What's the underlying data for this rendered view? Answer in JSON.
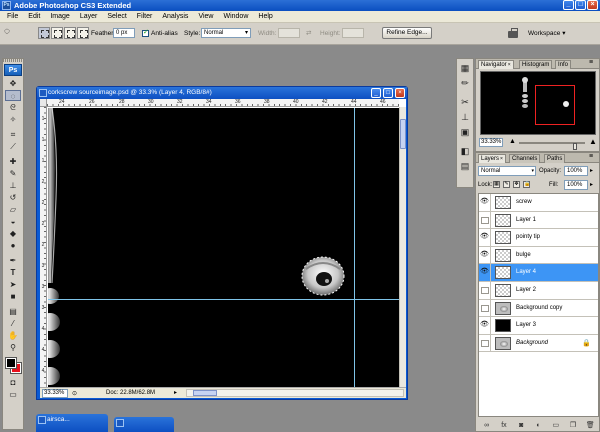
{
  "app": {
    "title": "Adobe Photoshop CS3 Extended",
    "icon": "photoshop-icon",
    "logo": "Ps"
  },
  "window_controls": [
    "minimize",
    "maximize",
    "close"
  ],
  "menu": [
    "File",
    "Edit",
    "Image",
    "Layer",
    "Select",
    "Filter",
    "Analysis",
    "View",
    "Window",
    "Help"
  ],
  "options_bar": {
    "feather_label": "Feather:",
    "feather_value": "0 px",
    "antialias_label": "Anti-alias",
    "antialias_checked": true,
    "style_label": "Style:",
    "style_value": "Normal",
    "width_label": "Width:",
    "height_label": "Height:",
    "refine_edge": "Refine Edge...",
    "workspace": "Workspace"
  },
  "toolbox": {
    "tools": [
      "move-tool-icon",
      "marquee-tool-icon",
      "lasso-tool-icon",
      "magic-wand-icon",
      "crop-tool-icon",
      "slice-tool-icon",
      "healing-brush-icon",
      "brush-tool-icon",
      "clone-stamp-icon",
      "history-brush-icon",
      "eraser-tool-icon",
      "paint-bucket-icon",
      "blur-tool-icon",
      "dodge-tool-icon",
      "pen-tool-icon",
      "type-tool-icon",
      "path-selection-icon",
      "shape-tool-icon",
      "notes-tool-icon",
      "eyedropper-tool-icon",
      "hand-tool-icon",
      "zoom-tool-icon"
    ],
    "foreground_color": "#000000",
    "background_color": "#e8101c"
  },
  "document": {
    "title": "corkscrew sourceimage.psd @ 33.3% (Layer 4, RGB/8#)",
    "zoom": "33.33%",
    "doc_info": "Doc: 22.8M/62.8M",
    "ruler_h": [
      "24",
      "26",
      "28",
      "30",
      "32",
      "34",
      "36",
      "38",
      "40",
      "42",
      "44",
      "46"
    ],
    "ruler_v": [
      "1",
      "1",
      "1",
      "2",
      "2",
      "2",
      "2",
      "3",
      "3",
      "3",
      "4",
      "4",
      "4"
    ]
  },
  "minimized_docs": [
    {
      "title": "airsca..."
    },
    {
      "title": ""
    }
  ],
  "dock_icons": [
    "navigator-dock-icon",
    "info-dock-icon",
    "tools-dock-icon",
    "character-dock-icon",
    "brushes-dock-icon",
    "layers-dock-icon",
    "channels-dock-icon",
    "paths-dock-icon"
  ],
  "navigator_panel": {
    "tabs": [
      "Navigator",
      "Histogram",
      "Info"
    ],
    "zoom": "33.33%"
  },
  "layers_panel": {
    "tabs": [
      "Layers",
      "Channels",
      "Paths"
    ],
    "blend_mode": "Normal",
    "opacity_label": "Opacity:",
    "opacity": "100%",
    "lock_label": "Lock:",
    "fill_label": "Fill:",
    "fill": "100%",
    "layers": [
      {
        "name": "screw",
        "visible": true,
        "thumb": "transparent",
        "selected": false
      },
      {
        "name": "Layer 1",
        "visible": false,
        "thumb": "transparent",
        "selected": false
      },
      {
        "name": "pointy tip",
        "visible": true,
        "thumb": "transparent",
        "selected": false
      },
      {
        "name": "bulge",
        "visible": true,
        "thumb": "transparent",
        "selected": false
      },
      {
        "name": "Layer 4",
        "visible": true,
        "thumb": "transparent",
        "selected": true
      },
      {
        "name": "Layer 2",
        "visible": false,
        "thumb": "transparent",
        "selected": false
      },
      {
        "name": "Background copy",
        "visible": false,
        "thumb": "photo",
        "selected": false
      },
      {
        "name": "Layer 3",
        "visible": true,
        "thumb": "black",
        "selected": false
      },
      {
        "name": "Background",
        "visible": false,
        "thumb": "photo",
        "selected": false,
        "italic": true,
        "locked": true
      }
    ],
    "bottom_icons": [
      "link-layers-icon",
      "layer-style-icon",
      "layer-mask-icon",
      "adjustment-layer-icon",
      "new-group-icon",
      "new-layer-icon",
      "delete-layer-icon"
    ]
  },
  "colors": {
    "selection_blue": "#3d95f5",
    "titlebar_blue": "#0a4ec0",
    "guide": "#7fc4e8"
  }
}
